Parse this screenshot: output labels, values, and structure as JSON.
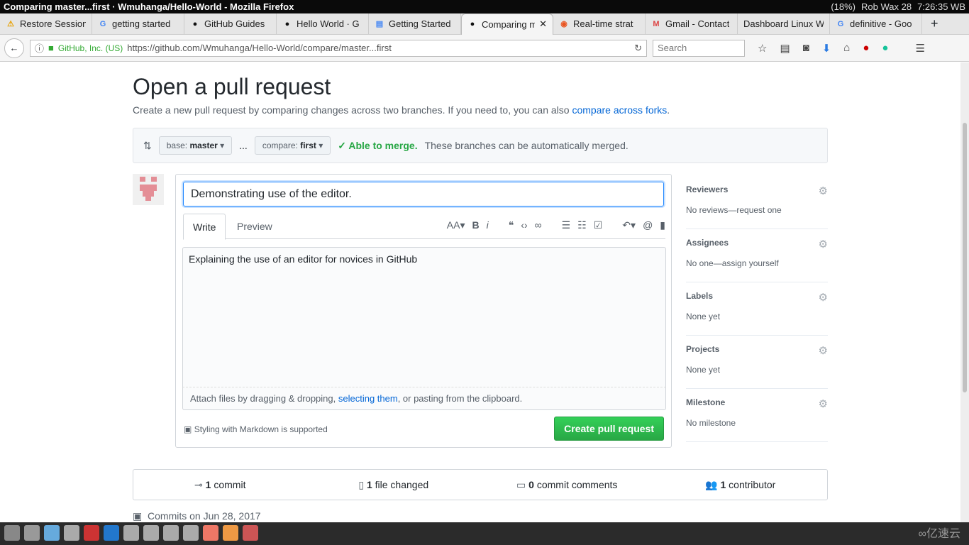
{
  "window": {
    "title": "Comparing master...first · Wmuhanga/Hello-World - Mozilla Firefox",
    "status": "(18%)",
    "user": "Rob Wax 28",
    "clock": "7:26:35 WB"
  },
  "tabs": [
    {
      "label": "Restore Session",
      "icon": "warning-icon"
    },
    {
      "label": "getting started",
      "icon": "google-icon"
    },
    {
      "label": "GitHub Guides",
      "icon": "github-icon"
    },
    {
      "label": "Hello World · G",
      "icon": "github-icon"
    },
    {
      "label": "Getting Started",
      "icon": "docs-icon"
    },
    {
      "label": "Comparing master",
      "icon": "github-icon",
      "active": true
    },
    {
      "label": "Real-time strat",
      "icon": "ubuntu-icon"
    },
    {
      "label": "Gmail - Contact",
      "icon": "gmail-icon"
    },
    {
      "label": "Dashboard Linux W",
      "icon": ""
    },
    {
      "label": "definitive - Goo",
      "icon": "google-icon"
    }
  ],
  "nav": {
    "identity": "GitHub, Inc. (US)",
    "url": "https://github.com/Wmuhanga/Hello-World/compare/master...first",
    "search_placeholder": "Search"
  },
  "page": {
    "title": "Open a pull request",
    "subtitle": "Create a new pull request by comparing changes across two branches. If you need to, you can also ",
    "subtitle_link": "compare across forks",
    "base_label": "base:",
    "base": "master",
    "ellipsis": "...",
    "compare_label": "compare:",
    "compare": "first",
    "merge_status": "Able to merge.",
    "merge_text": "These branches can be automatically merged.",
    "pr_title": "Demonstrating use of the editor.",
    "write_tab": "Write",
    "preview_tab": "Preview",
    "body": "Explaining the use of an editor for novices in GitHub",
    "attach_pre": "Attach files by dragging & dropping, ",
    "attach_link": "selecting them",
    "attach_post": ", or pasting from the clipboard.",
    "markdown_note": "Styling with Markdown is supported",
    "create_button": "Create pull request",
    "sidebar": [
      {
        "title": "Reviewers",
        "value": "No reviews—request one"
      },
      {
        "title": "Assignees",
        "value": "No one—assign yourself"
      },
      {
        "title": "Labels",
        "value": "None yet"
      },
      {
        "title": "Projects",
        "value": "None yet"
      },
      {
        "title": "Milestone",
        "value": "No milestone"
      }
    ],
    "summary": [
      {
        "count": "1",
        "label": "commit"
      },
      {
        "count": "1",
        "label": "file changed"
      },
      {
        "count": "0",
        "label": "commit comments"
      },
      {
        "count": "1",
        "label": "contributor"
      }
    ],
    "commits_on": "Commits on Jun 28, 2017"
  },
  "watermark": "亿速云"
}
